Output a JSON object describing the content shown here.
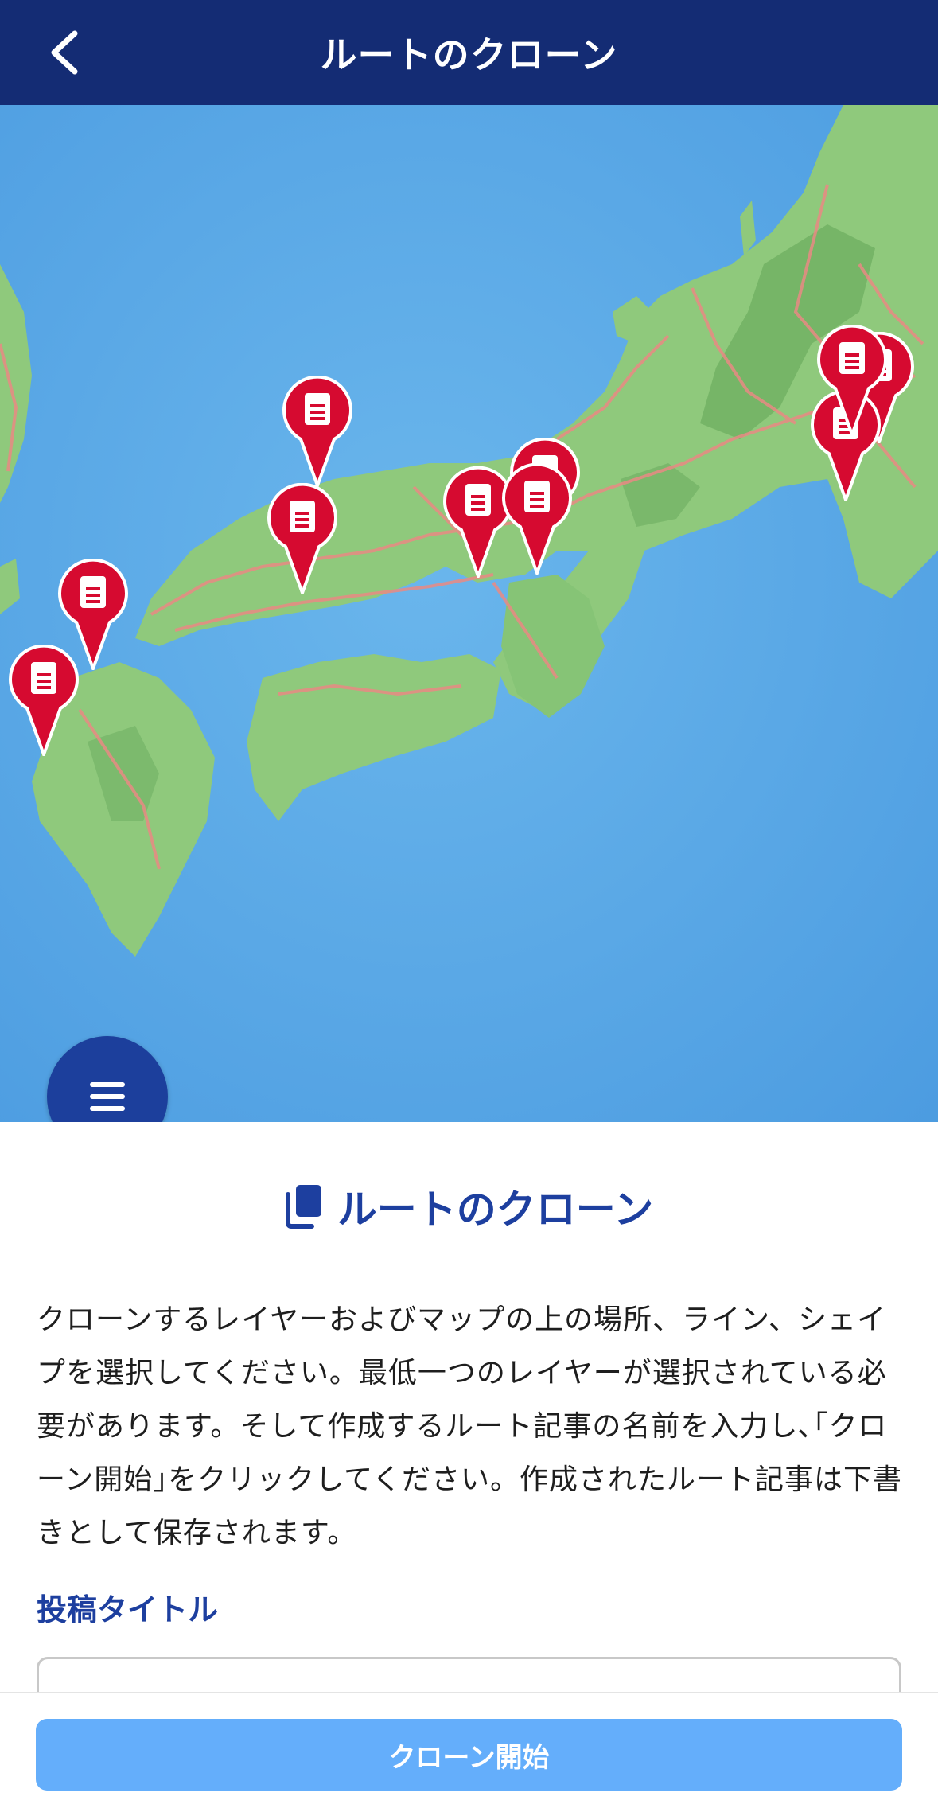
{
  "header": {
    "title": "ルートのクローン",
    "back_icon": "chevron-left-icon",
    "background_color": "#142c74"
  },
  "map": {
    "attribution_logo": "mapbox",
    "info_icon": "info-icon",
    "menu_icon": "hamburger-menu-icon",
    "marker_icon": "document-pin-icon",
    "marker_color": "#d60a30",
    "marker_count": 12
  },
  "panel": {
    "title": "ルートのクローン",
    "title_icon": "copy-icon",
    "description": "クローンするレイヤーおよびマップの上の場所、ライン、シェイプを選択してください。最低一つのレイヤーが選択されている必要があります。そして作成するルート記事の名前を入力し､｢クローン開始｣をクリックしてください。作成されたルート記事は下書きとして保存されます。",
    "field_label": "投稿タイトル",
    "input_value": "",
    "accent_color": "#1d3f9f"
  },
  "footer": {
    "button_label": "クローン開始",
    "button_color": "#64aefb"
  }
}
